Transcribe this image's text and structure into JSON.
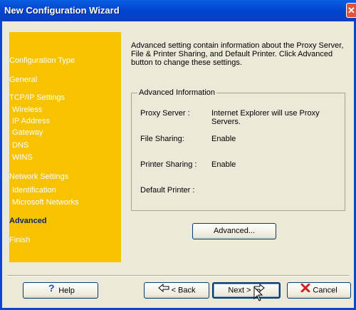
{
  "window": {
    "title": "New Configuration Wizard",
    "close_glyph": "✕"
  },
  "sidebar": {
    "items": [
      {
        "label": "Configuration Type"
      },
      {
        "label": "General"
      },
      {
        "label": "TCP/IP Settings"
      },
      {
        "label": "Wireless"
      },
      {
        "label": "IP Address"
      },
      {
        "label": "Gateway"
      },
      {
        "label": "DNS"
      },
      {
        "label": "WINS"
      },
      {
        "label": "Network Settings"
      },
      {
        "label": "Identification"
      },
      {
        "label": "Microsoft Networks"
      },
      {
        "label": "Advanced"
      },
      {
        "label": "Finish"
      }
    ]
  },
  "main": {
    "intro_text": "Advanced setting contain information about the Proxy Server, File & Printer Sharing, and Default Printer. Click Advanced button to change these settings.",
    "group_title": "Advanced Information",
    "rows": [
      {
        "label": "Proxy Server :",
        "value": "Internet Explorer will use Proxy Servers."
      },
      {
        "label": "File Sharing:",
        "value": "Enable"
      },
      {
        "label": "Printer Sharing :",
        "value": "Enable"
      },
      {
        "label": "Default Printer :",
        "value": ""
      }
    ],
    "advanced_button": "Advanced..."
  },
  "footer": {
    "help_label": "Help",
    "back_label": "< Back",
    "next_label": "Next >",
    "cancel_label": "Cancel"
  },
  "colors": {
    "sidebar_bg": "#f7c301",
    "title_bar": "#0a46d2",
    "active_step": "#0a246a"
  },
  "icons": [
    "close-icon",
    "help-icon",
    "back-arrow-icon",
    "next-arrow-icon",
    "cancel-x-icon",
    "mouse-cursor-icon"
  ]
}
